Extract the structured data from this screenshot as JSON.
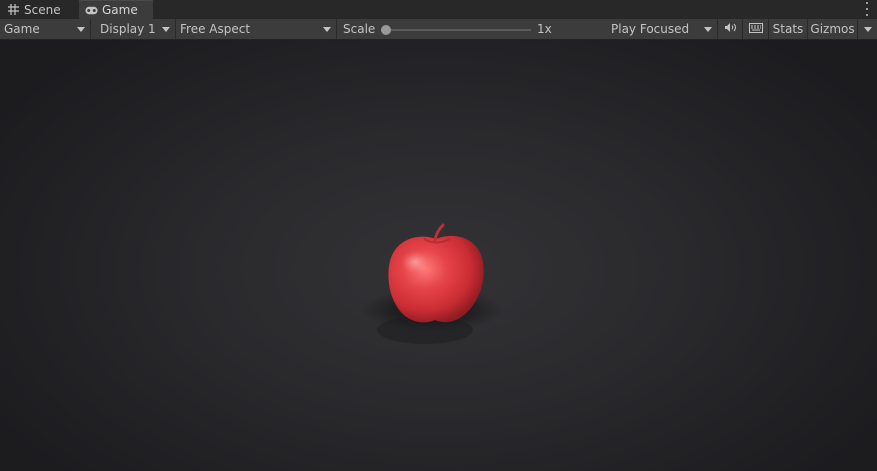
{
  "tabs": [
    {
      "label": "Scene",
      "icon": "grid-icon"
    },
    {
      "label": "Game",
      "icon": "gamepad-icon",
      "active": true
    }
  ],
  "toolbar": {
    "view_select": "Game",
    "display_select": "Display 1",
    "aspect_select": "Free Aspect",
    "scale_label": "Scale",
    "scale_value": "1x",
    "play_mode_select": "Play Focused",
    "audio_icon": "speaker-icon",
    "keyboard_icon": "keyboard-icon",
    "stats_label": "Stats",
    "gizmos_label": "Gizmos"
  },
  "colors": {
    "apple": "#d83a3e",
    "background": "#2a2a2d"
  }
}
